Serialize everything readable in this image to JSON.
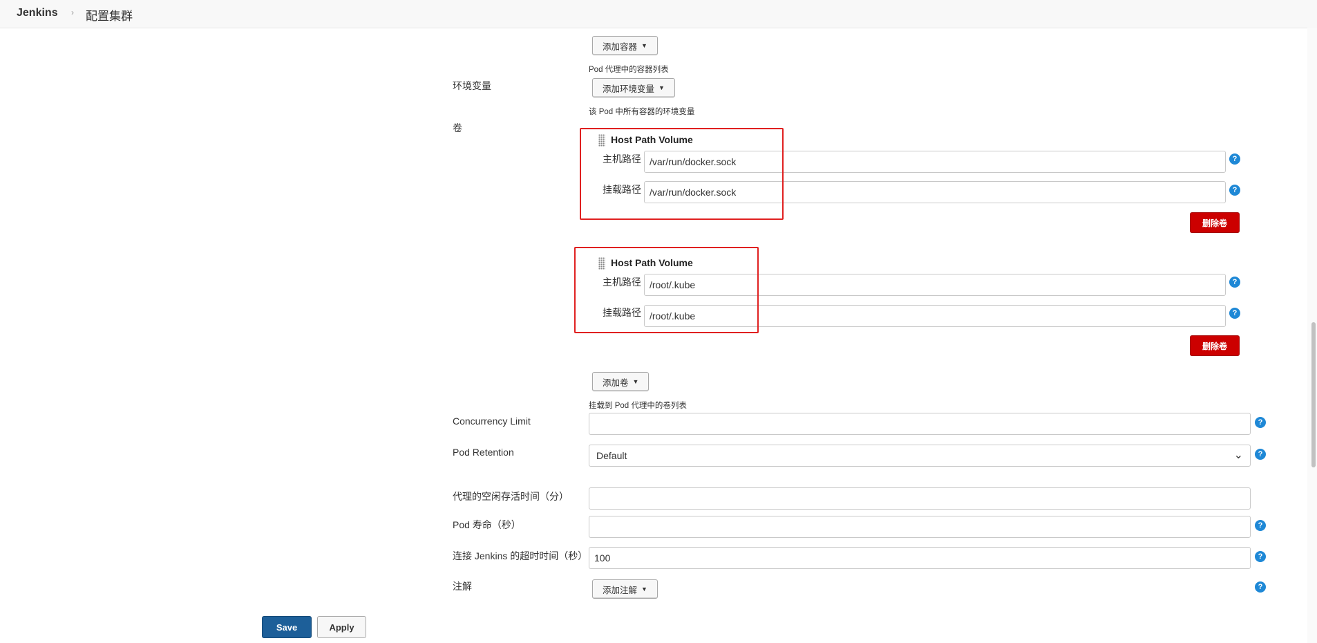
{
  "header": {
    "brand": "Jenkins",
    "separator": "›",
    "breadcrumb": "配置集群"
  },
  "containers": {
    "add_button": "添加容器",
    "hint": "Pod 代理中的容器列表"
  },
  "env": {
    "label": "环境变量",
    "add_button": "添加环境变量",
    "hint": "该 Pod 中所有容器的环境变量"
  },
  "volumes": {
    "label": "卷",
    "items": [
      {
        "title": "Host Path Volume",
        "host_path_label": "主机路径",
        "host_path": "/var/run/docker.sock",
        "mount_path_label": "挂载路径",
        "mount_path": "/var/run/docker.sock",
        "delete_button": "删除卷"
      },
      {
        "title": "Host Path Volume",
        "host_path_label": "主机路径",
        "host_path": "/root/.kube",
        "mount_path_label": "挂载路径",
        "mount_path": "/root/.kube",
        "delete_button": "删除卷"
      }
    ],
    "add_button": "添加卷",
    "hint": "挂载到 Pod 代理中的卷列表"
  },
  "concurrency": {
    "label": "Concurrency Limit",
    "value": ""
  },
  "retention": {
    "label": "Pod Retention",
    "selected": "Default"
  },
  "idle": {
    "label": "代理的空闲存活时间（分）",
    "value": ""
  },
  "pod_life": {
    "label": "Pod 寿命（秒）",
    "value": ""
  },
  "timeout": {
    "label": "连接 Jenkins 的超时时间（秒）",
    "value": "100"
  },
  "annotations": {
    "label": "注解",
    "add_button": "添加注解"
  },
  "help_glyph": "?",
  "caret_glyph": "▼",
  "select_arrow": "⌄",
  "footer": {
    "save": "Save",
    "apply": "Apply"
  },
  "colors": {
    "save_bg": "#1d5f99",
    "delete_bg": "#cc0000",
    "help_bg": "#1e88d6",
    "highlight": "#e02020"
  }
}
